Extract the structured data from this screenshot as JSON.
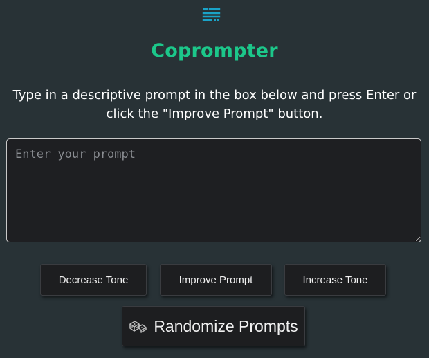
{
  "app": {
    "logo_icon": "quote-lines-icon",
    "title": "Coprompter",
    "instructions": "Type in a descriptive prompt in the box below and press Enter or click the \"Improve Prompt\" button."
  },
  "prompt": {
    "placeholder": "Enter your prompt",
    "value": ""
  },
  "buttons": {
    "decrease_tone": "Decrease Tone",
    "improve_prompt": "Improve Prompt",
    "increase_tone": "Increase Tone",
    "randomize_prompts": "Randomize Prompts",
    "randomize_icon": "dice-icon"
  },
  "colors": {
    "background": "#283236",
    "accent": "#1cc78a",
    "logo": "#1aa3c8",
    "button_bg": "#1d1e20"
  }
}
